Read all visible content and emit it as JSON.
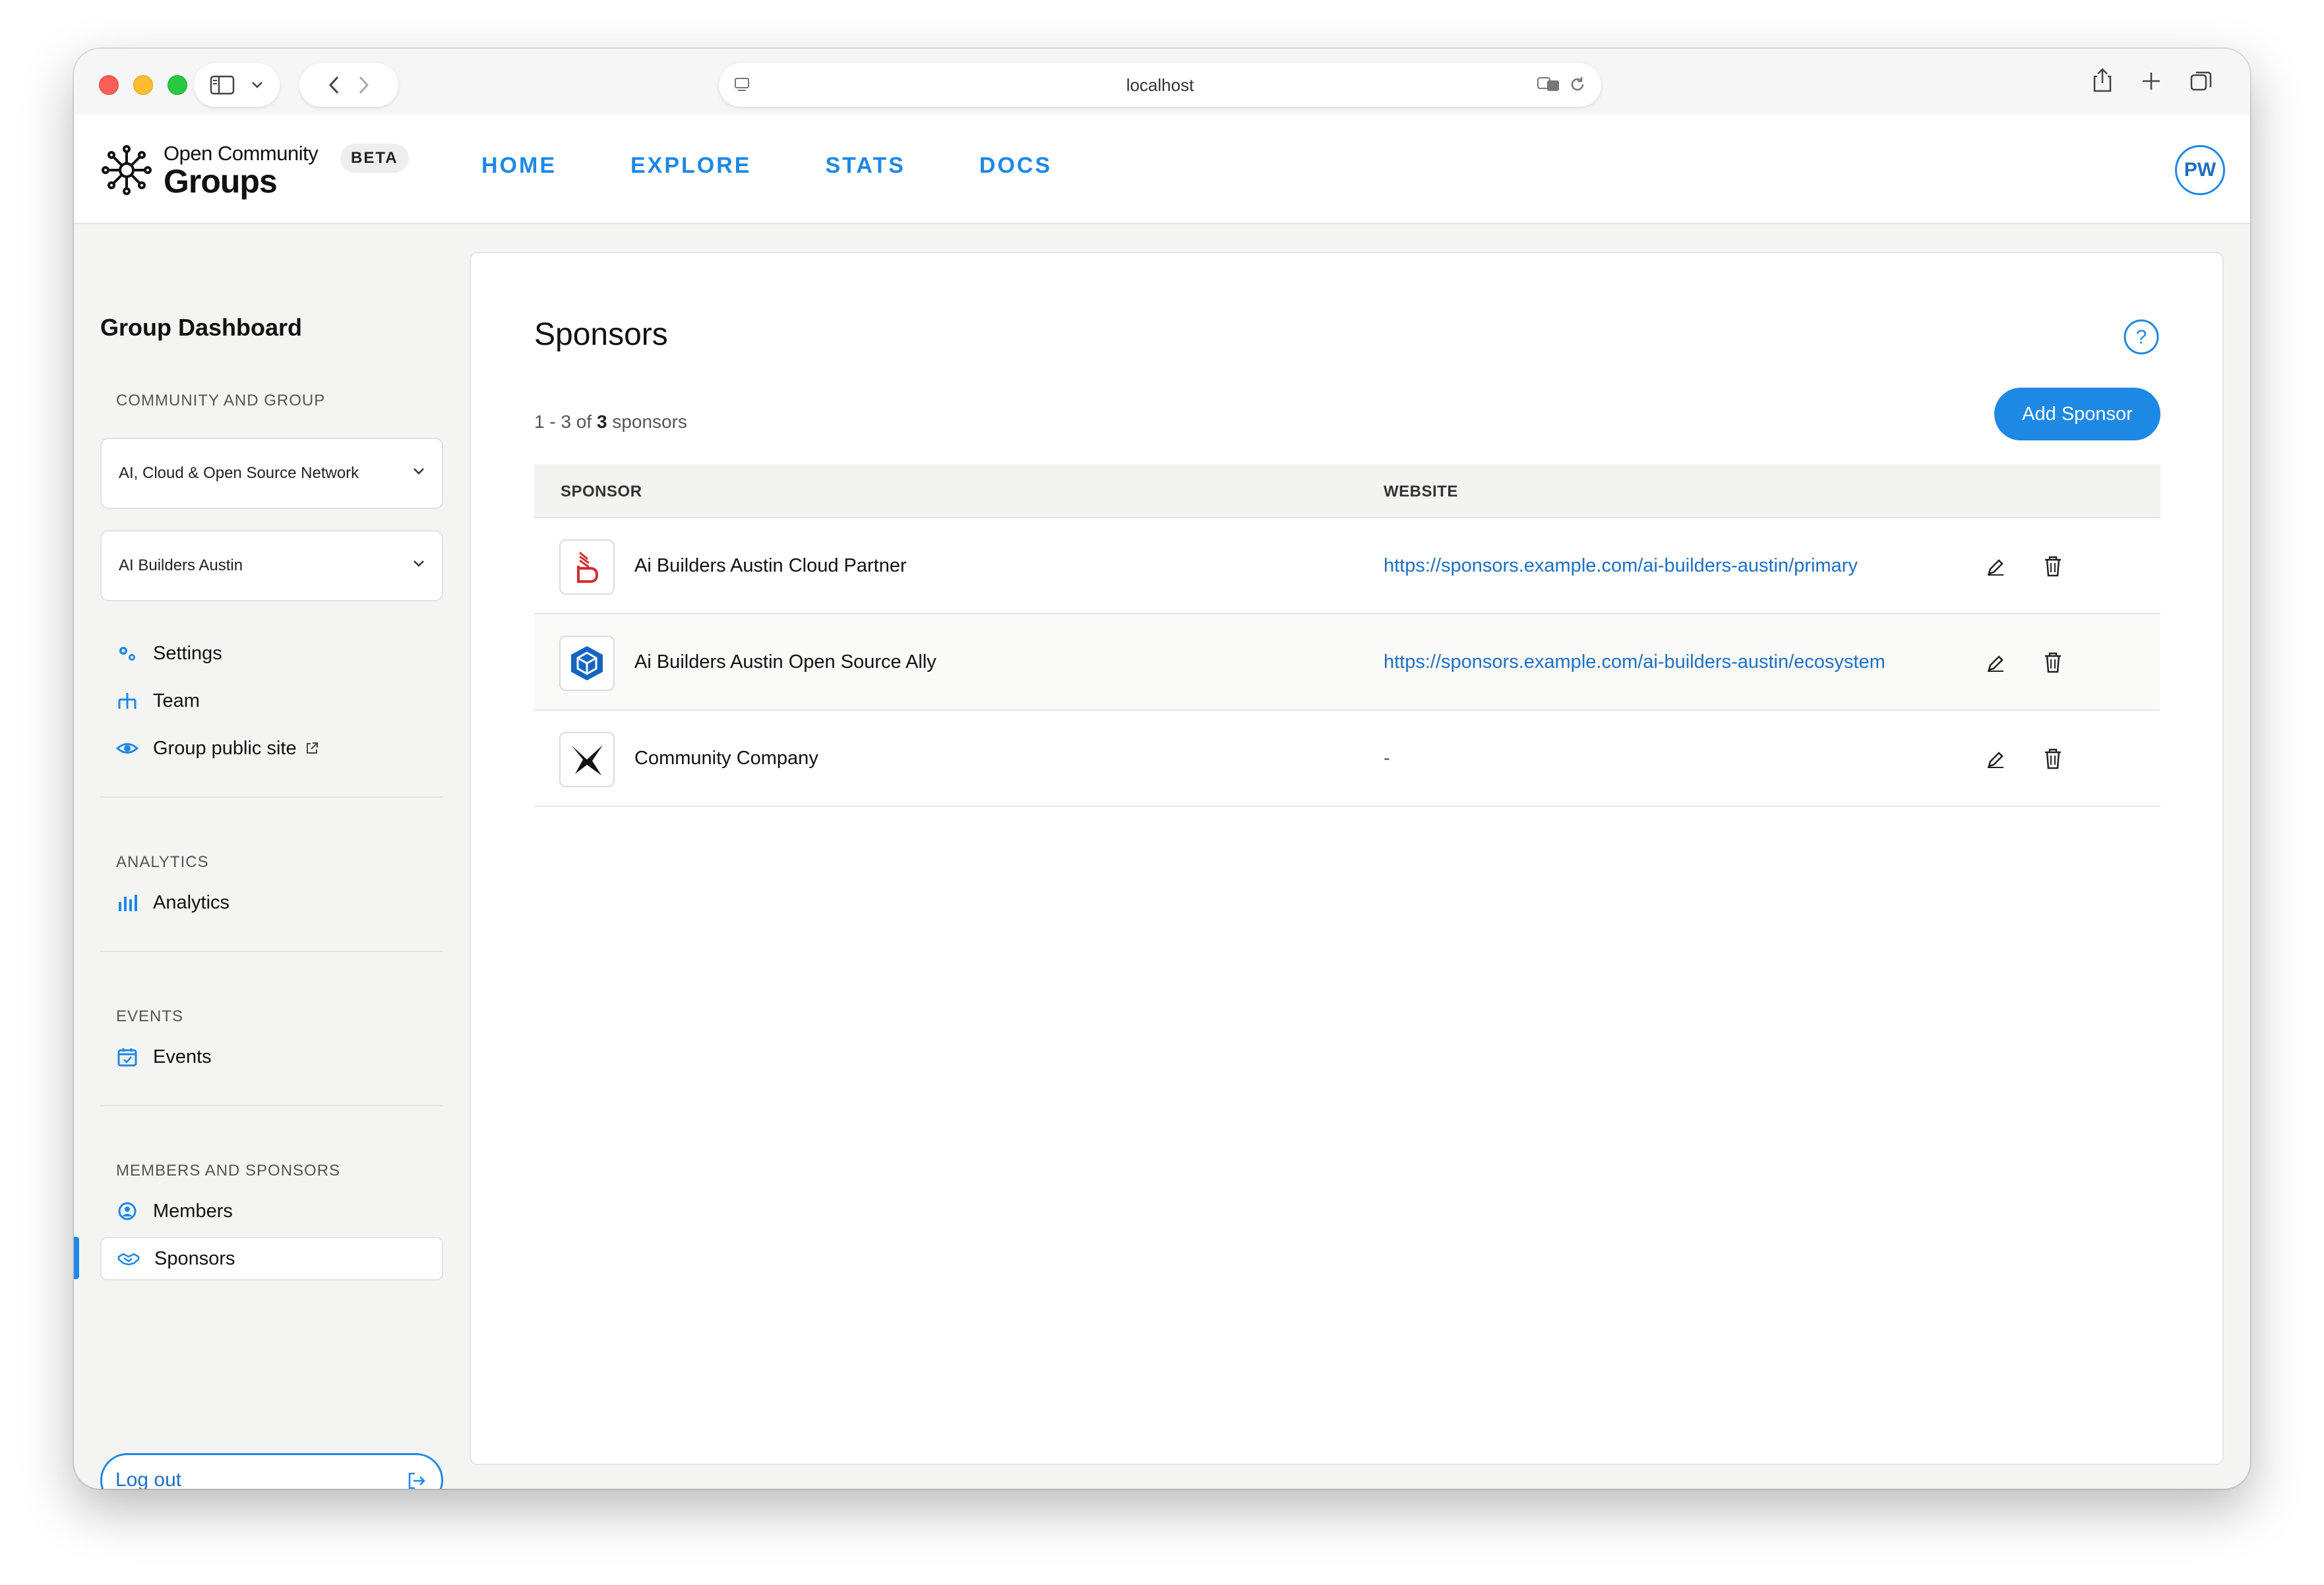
{
  "browser": {
    "url": "localhost"
  },
  "brand": {
    "line1": "Open Community",
    "line2": "Groups",
    "badge": "BETA"
  },
  "nav": [
    {
      "label": "HOME"
    },
    {
      "label": "EXPLORE"
    },
    {
      "label": "STATS"
    },
    {
      "label": "DOCS"
    }
  ],
  "user": {
    "initials": "PW"
  },
  "sidebar": {
    "title": "Group Dashboard",
    "section_community": "COMMUNITY AND GROUP",
    "community_select": "AI, Cloud & Open Source Network",
    "group_select": "AI Builders Austin",
    "items_group": [
      {
        "label": "Settings",
        "icon": "gears-icon"
      },
      {
        "label": "Team",
        "icon": "team-icon"
      },
      {
        "label": "Group public site",
        "icon": "eye-icon"
      }
    ],
    "section_analytics": "ANALYTICS",
    "analytics_label": "Analytics",
    "section_events": "EVENTS",
    "events_label": "Events",
    "section_members": "MEMBERS AND SPONSORS",
    "members_label": "Members",
    "sponsors_label": "Sponsors",
    "logout_label": "Log out"
  },
  "main": {
    "title": "Sponsors",
    "count_prefix": "1 - 3 of",
    "count_total": "3",
    "count_suffix": "sponsors",
    "add_button": "Add Sponsor",
    "columns": {
      "sponsor": "SPONSOR",
      "website": "WEBSITE"
    },
    "rows": [
      {
        "name": "Ai Builders Austin Cloud Partner",
        "website": "https://sponsors.example.com/ai-builders-austin/primary",
        "logo": "cloud-partner-logo"
      },
      {
        "name": "Ai Builders Austin Open Source Ally",
        "website": "https://sponsors.example.com/ai-builders-austin/ecosystem",
        "logo": "open-source-ally-logo"
      },
      {
        "name": "Community Company",
        "website": "-",
        "logo": "community-company-logo"
      }
    ]
  },
  "colors": {
    "accent": "#1e88e5",
    "link": "#1e6fc4"
  }
}
